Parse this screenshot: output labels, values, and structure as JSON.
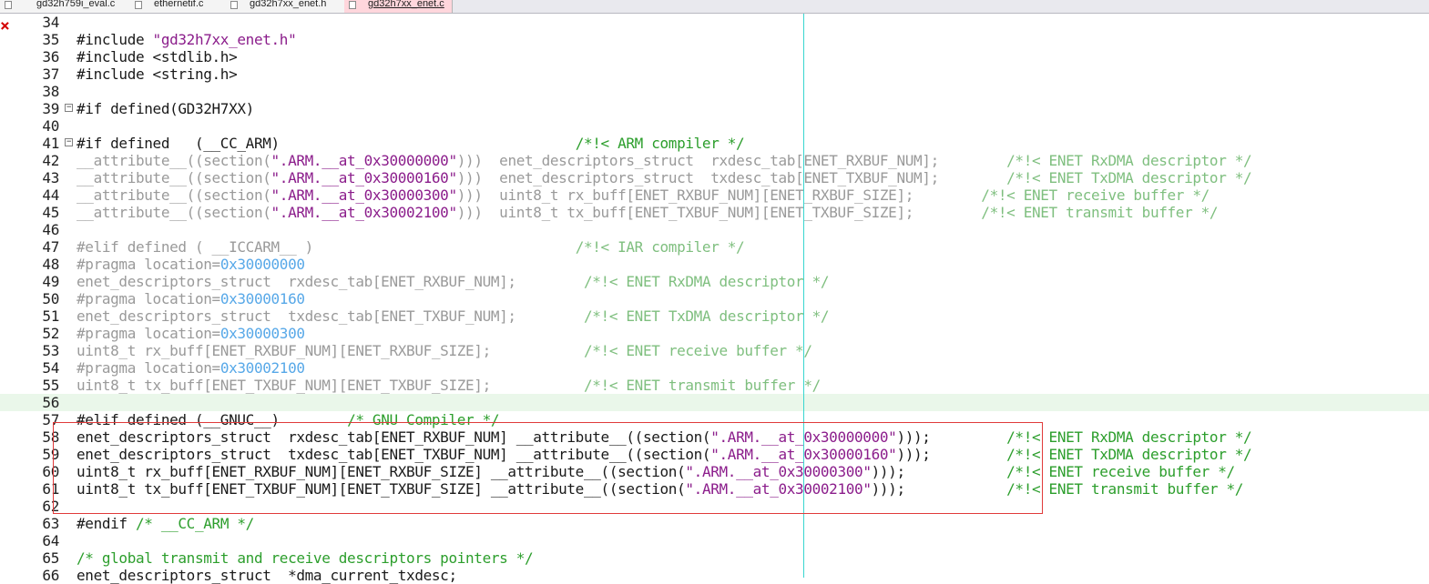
{
  "tabs": [
    {
      "label": "gd32h759i_eval.c",
      "active": false
    },
    {
      "label": "ethernetif.c",
      "active": false
    },
    {
      "label": "gd32h7xx_enet.h",
      "active": false
    },
    {
      "label": "gd32h7xx_enet.c",
      "active": true
    }
  ],
  "editor": {
    "error_marker_line": 35,
    "error_marker_glyph": "×",
    "highlighted_line": 56,
    "colors": {
      "comment": "#2c9e2c",
      "string": "#8b1d8b",
      "hex": "#57a8e8",
      "inactive": "#9a9a9a",
      "box": "#e03a3a",
      "guide": "#38d6d0"
    },
    "lines": [
      {
        "n": "34",
        "fold": "",
        "text": "",
        "class": "t-norm"
      },
      {
        "n": "35",
        "fold": "",
        "text": "#include \"gd32h7xx_enet.h\"",
        "class": "t-norm"
      },
      {
        "n": "36",
        "fold": "",
        "text": "#include <stdlib.h>",
        "class": "t-norm"
      },
      {
        "n": "37",
        "fold": "",
        "text": "#include <string.h>",
        "class": "t-norm"
      },
      {
        "n": "38",
        "fold": "",
        "text": "",
        "class": "t-norm"
      },
      {
        "n": "39",
        "fold": "−",
        "text": "#if defined(GD32H7XX)",
        "class": "t-norm"
      },
      {
        "n": "40",
        "fold": "",
        "text": "",
        "class": "t-norm"
      },
      {
        "n": "41",
        "fold": "−",
        "text": "#if defined   (__CC_ARM)                                   /*!< ARM compiler */",
        "class": "t-norm"
      },
      {
        "n": "42",
        "fold": "",
        "text": "__attribute__((section(\".ARM.__at_0x30000000\")))  enet_descriptors_struct  rxdesc_tab[ENET_RXBUF_NUM];        /*!< ENET RxDMA descriptor */",
        "class": "t-gray"
      },
      {
        "n": "43",
        "fold": "",
        "text": "__attribute__((section(\".ARM.__at_0x30000160\")))  enet_descriptors_struct  txdesc_tab[ENET_TXBUF_NUM];        /*!< ENET TxDMA descriptor */",
        "class": "t-gray"
      },
      {
        "n": "44",
        "fold": "",
        "text": "__attribute__((section(\".ARM.__at_0x30000300\")))  uint8_t rx_buff[ENET_RXBUF_NUM][ENET_RXBUF_SIZE];        /*!< ENET receive buffer */",
        "class": "t-gray"
      },
      {
        "n": "45",
        "fold": "",
        "text": "__attribute__((section(\".ARM.__at_0x30002100\")))  uint8_t tx_buff[ENET_TXBUF_NUM][ENET_TXBUF_SIZE];        /*!< ENET transmit buffer */",
        "class": "t-gray"
      },
      {
        "n": "46",
        "fold": "",
        "text": "",
        "class": "t-norm"
      },
      {
        "n": "47",
        "fold": "",
        "text": "#elif defined ( __ICCARM__ )                               /*!< IAR compiler */",
        "class": "t-gray"
      },
      {
        "n": "48",
        "fold": "",
        "text": "#pragma location=0x30000000",
        "class": "t-gray"
      },
      {
        "n": "49",
        "fold": "",
        "text": "enet_descriptors_struct  rxdesc_tab[ENET_RXBUF_NUM];        /*!< ENET RxDMA descriptor */",
        "class": "t-gray"
      },
      {
        "n": "50",
        "fold": "",
        "text": "#pragma location=0x30000160",
        "class": "t-gray"
      },
      {
        "n": "51",
        "fold": "",
        "text": "enet_descriptors_struct  txdesc_tab[ENET_TXBUF_NUM];        /*!< ENET TxDMA descriptor */",
        "class": "t-gray"
      },
      {
        "n": "52",
        "fold": "",
        "text": "#pragma location=0x30000300",
        "class": "t-gray"
      },
      {
        "n": "53",
        "fold": "",
        "text": "uint8_t rx_buff[ENET_RXBUF_NUM][ENET_RXBUF_SIZE];           /*!< ENET receive buffer */",
        "class": "t-gray"
      },
      {
        "n": "54",
        "fold": "",
        "text": "#pragma location=0x30002100",
        "class": "t-gray"
      },
      {
        "n": "55",
        "fold": "",
        "text": "uint8_t tx_buff[ENET_TXBUF_NUM][ENET_TXBUF_SIZE];           /*!< ENET transmit buffer */",
        "class": "t-gray"
      },
      {
        "n": "56",
        "fold": "",
        "text": "",
        "class": "t-norm"
      },
      {
        "n": "57",
        "fold": "",
        "text": "#elif defined (__GNUC__)        /* GNU Compiler */",
        "class": "t-norm"
      },
      {
        "n": "58",
        "fold": "",
        "text": "enet_descriptors_struct  rxdesc_tab[ENET_RXBUF_NUM] __attribute__((section(\".ARM.__at_0x30000000\")));         /*!< ENET RxDMA descriptor */",
        "class": "t-norm"
      },
      {
        "n": "59",
        "fold": "",
        "text": "enet_descriptors_struct  txdesc_tab[ENET_TXBUF_NUM] __attribute__((section(\".ARM.__at_0x30000160\")));         /*!< ENET TxDMA descriptor */",
        "class": "t-norm"
      },
      {
        "n": "60",
        "fold": "",
        "text": "uint8_t rx_buff[ENET_RXBUF_NUM][ENET_RXBUF_SIZE] __attribute__((section(\".ARM.__at_0x30000300\")));            /*!< ENET receive buffer */",
        "class": "t-norm"
      },
      {
        "n": "61",
        "fold": "",
        "text": "uint8_t tx_buff[ENET_TXBUF_NUM][ENET_TXBUF_SIZE] __attribute__((section(\".ARM.__at_0x30002100\")));            /*!< ENET transmit buffer */",
        "class": "t-norm"
      },
      {
        "n": "62",
        "fold": "",
        "text": "",
        "class": "t-norm"
      },
      {
        "n": "63",
        "fold": "",
        "text": "#endif /* __CC_ARM */",
        "class": "t-norm"
      },
      {
        "n": "64",
        "fold": "",
        "text": "",
        "class": "t-norm"
      },
      {
        "n": "65",
        "fold": "",
        "text": "/* global transmit and receive descriptors pointers */",
        "class": "t-norm"
      },
      {
        "n": "66",
        "fold": "",
        "text": "enet_descriptors_struct  *dma_current_txdesc;",
        "class": "t-norm"
      }
    ]
  }
}
